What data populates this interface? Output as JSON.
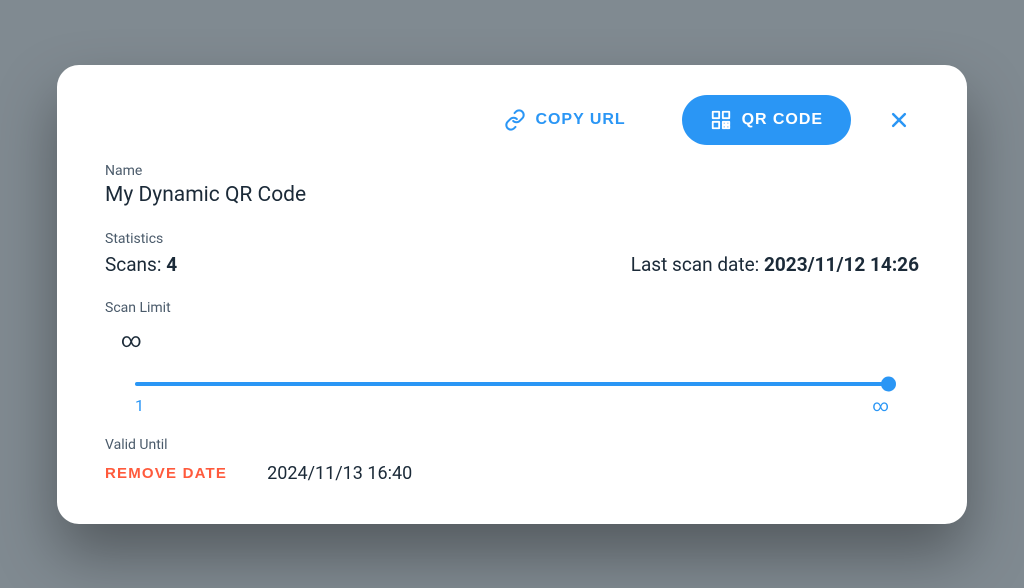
{
  "actions": {
    "copy_url_label": "COPY URL",
    "qr_code_label": "QR CODE"
  },
  "labels": {
    "name": "Name",
    "statistics": "Statistics",
    "scans": "Scans:",
    "last_scan": "Last scan date:",
    "scan_limit": "Scan Limit",
    "valid_until": "Valid Until",
    "remove_date": "REMOVE DATE"
  },
  "name_value": "My Dynamic QR Code",
  "statistics": {
    "scans_value": "4",
    "last_scan_value": "2023/11/12 14:26"
  },
  "scan_limit": {
    "current": "∞",
    "min_label": "1",
    "max_label": "∞"
  },
  "valid_until_value": "2024/11/13 16:40",
  "colors": {
    "accent": "#2a96f5",
    "danger": "#ff5a3c"
  }
}
